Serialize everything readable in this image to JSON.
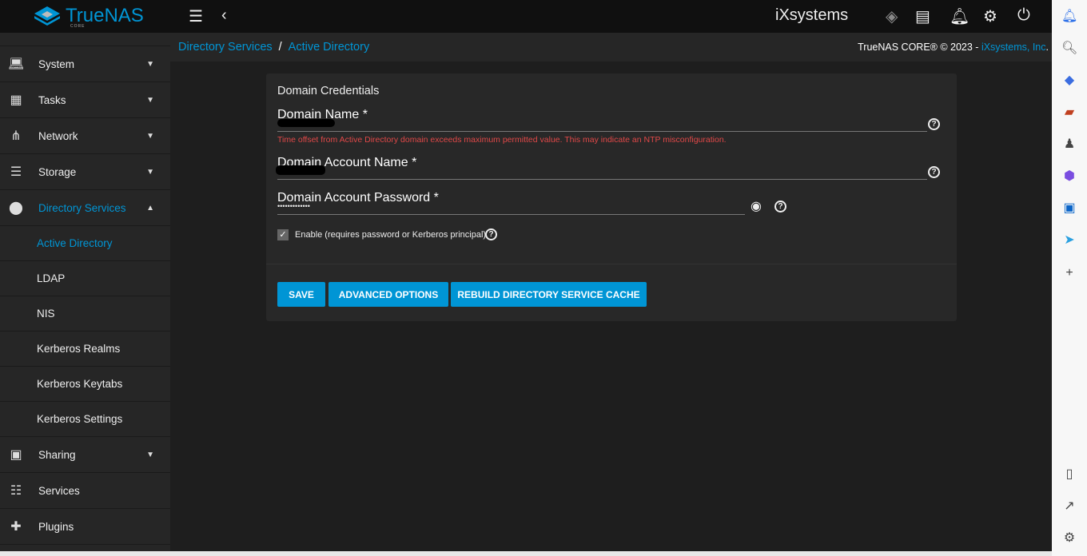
{
  "header": {
    "brand": "TrueNAS",
    "brand_sub": "CORE",
    "vendor_logo": "iXsystems"
  },
  "sidebar": {
    "items": [
      {
        "label": "System",
        "icon": "laptop-icon"
      },
      {
        "label": "Tasks",
        "icon": "calendar-icon"
      },
      {
        "label": "Network",
        "icon": "network-icon"
      },
      {
        "label": "Storage",
        "icon": "storage-icon"
      },
      {
        "label": "Directory Services",
        "icon": "directory-icon"
      },
      {
        "label": "Active Directory"
      },
      {
        "label": "LDAP"
      },
      {
        "label": "NIS"
      },
      {
        "label": "Kerberos Realms"
      },
      {
        "label": "Kerberos Keytabs"
      },
      {
        "label": "Kerberos Settings"
      },
      {
        "label": "Sharing",
        "icon": "sharing-icon"
      },
      {
        "label": "Services",
        "icon": "tune-icon"
      },
      {
        "label": "Plugins",
        "icon": "puzzle-icon"
      }
    ]
  },
  "breadcrumb": {
    "parent": "Directory Services",
    "sep": "/",
    "current": "Active Directory"
  },
  "copyright": {
    "text": "TrueNAS CORE® © 2023 - ",
    "link": "iXsystems, Inc",
    "end": "."
  },
  "form": {
    "title": "Domain Credentials",
    "domain_name_label": "Domain Name *",
    "error": "Time offset from Active Directory domain exceeds maximum permitted value. This may indicate an NTP misconfiguration.",
    "account_name_label": "Domain Account Name *",
    "password_label": "Domain Account Password *",
    "password_value": "•••••••••••••",
    "enable_label": "Enable (requires password or Kerberos principal)",
    "enable_checked": true,
    "save": "SAVE",
    "advanced": "ADVANCED OPTIONS",
    "rebuild": "REBUILD DIRECTORY SERVICE CACHE"
  }
}
